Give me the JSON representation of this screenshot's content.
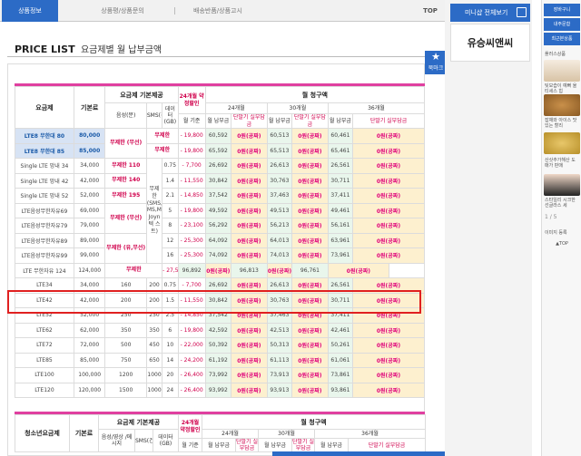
{
  "tabs": {
    "info": "상품정보",
    "review": "상품평/상품문의",
    "delivery": "배송반품/상품고시",
    "top": "TOP"
  },
  "title": {
    "en": "PRICE LIST",
    "ko": "요금제별 월 납부금액"
  },
  "badge": "북마크",
  "mini": {
    "title": "미니샵 전체보기",
    "seller": "유승씨앤씨"
  },
  "rail": {
    "cart": "장바구니",
    "order": "내주문함",
    "recent": "최근본상품",
    "count_label": "플러스상품",
    "pager": "1 / 5",
    "items": [
      "팃모습이 예뻐 울티세스 힙",
      "잡채와 아이스 맛있는 할리",
      "산삿추가해산 도매가 판매",
      "스타일리 시크한 선글라스 세"
    ],
    "delete": "이미지 등록",
    "top": "▲TOP"
  },
  "table": {
    "header": {
      "plan": "요금제",
      "base": "기본료",
      "provide": "요금제 기본제공",
      "voice": "음성(분)",
      "voice_sub": "망내 망외",
      "sms": "SMS(건)",
      "data": "데이터(GB)",
      "discount": "24개월 약정할인",
      "monthly": "월 기준",
      "bill": "월 청구액",
      "m24": "24개월",
      "m30": "30개월",
      "m36": "36개월",
      "pay": "월 납부금",
      "device": "단말기 실부담금"
    },
    "rows": [
      {
        "plan": "LTE8 무한대 80",
        "base": "80,000",
        "voice": "무제한 (무선)",
        "sms": "무제한",
        "data": "",
        "disc": "- 19,800",
        "p24": "60,592",
        "d24": "0원(공짜)",
        "p30": "60,513",
        "d30": "0원(공짜)",
        "p36": "60,461",
        "d36": "0원(공짜)"
      },
      {
        "plan": "LTE8 무한대 85",
        "base": "85,000",
        "voice": "",
        "sms": "무제한",
        "data": "",
        "disc": "- 19,800",
        "p24": "65,592",
        "d24": "0원(공짜)",
        "p30": "65,513",
        "d30": "0원(공짜)",
        "p36": "65,461",
        "d36": "0원(공짜)"
      },
      {
        "plan": "Single LTE 망내 34",
        "base": "34,000",
        "voice": "무제한 110",
        "sms": "",
        "data": "0.75",
        "disc": "- 7,700",
        "p24": "26,692",
        "d24": "0원(공짜)",
        "p30": "26,613",
        "d30": "0원(공짜)",
        "p36": "26,561",
        "d36": "0원(공짜)"
      },
      {
        "plan": "Single LTE 망내 42",
        "base": "42,000",
        "voice": "무제한 140",
        "sms": "무제한 (SMS,L MS,MMS Joyn 텍 스트)",
        "data": "1.4",
        "disc": "- 11,550",
        "p24": "30,842",
        "d24": "0원(공짜)",
        "p30": "30,763",
        "d30": "0원(공짜)",
        "p36": "30,711",
        "d36": "0원(공짜)"
      },
      {
        "plan": "Single LTE 망내 52",
        "base": "52,000",
        "voice": "무제한 195",
        "sms": "",
        "data": "2.1",
        "disc": "- 14,850",
        "p24": "37,542",
        "d24": "0원(공짜)",
        "p30": "37,463",
        "d30": "0원(공짜)",
        "p36": "37,411",
        "d36": "0원(공짜)"
      },
      {
        "plan": "LTE음성무한자유69",
        "base": "69,000",
        "voice": "무제한 (무선)",
        "sms": "",
        "data": "5",
        "disc": "- 19,800",
        "p24": "49,592",
        "d24": "0원(공짜)",
        "p30": "49,513",
        "d30": "0원(공짜)",
        "p36": "49,461",
        "d36": "0원(공짜)"
      },
      {
        "plan": "LTE음성무한자유79",
        "base": "79,000",
        "voice": "",
        "sms": "",
        "data": "8",
        "disc": "- 23,100",
        "p24": "56,292",
        "d24": "0원(공짜)",
        "p30": "56,213",
        "d30": "0원(공짜)",
        "p36": "56,161",
        "d36": "0원(공짜)"
      },
      {
        "plan": "LTE음성무한자유89",
        "base": "89,000",
        "voice": "무제한 (유,무선)",
        "sms": "",
        "data": "12",
        "disc": "- 25,300",
        "p24": "64,092",
        "d24": "0원(공짜)",
        "p30": "64,013",
        "d30": "0원(공짜)",
        "p36": "63,961",
        "d36": "0원(공짜)"
      },
      {
        "plan": "LTE음성무한자유99",
        "base": "99,000",
        "voice": "",
        "sms": "",
        "data": "16",
        "disc": "- 25,300",
        "p24": "74,092",
        "d24": "0원(공짜)",
        "p30": "74,013",
        "d30": "0원(공짜)",
        "p36": "73,961",
        "d36": "0원(공짜)"
      },
      {
        "plan": "LTE 무한자유 124",
        "base": "124,000",
        "voice": "무제한",
        "sms": "",
        "data": "",
        "disc": "- 27,500",
        "p24": "96,892",
        "d24": "0원(공짜)",
        "p30": "96,813",
        "d30": "0원(공짜)",
        "p36": "96,761",
        "d36": "0원(공짜)"
      },
      {
        "plan": "LTE34",
        "base": "34,000",
        "voice": "160",
        "sms": "200",
        "data": "0.75",
        "disc": "- 7,700",
        "p24": "26,692",
        "d24": "0원(공짜)",
        "p30": "26,613",
        "d30": "0원(공짜)",
        "p36": "26,561",
        "d36": "0원(공짜)"
      },
      {
        "plan": "LTE42",
        "base": "42,000",
        "voice": "200",
        "sms": "200",
        "data": "1.5",
        "disc": "- 11,550",
        "p24": "30,842",
        "d24": "0원(공짜)",
        "p30": "30,763",
        "d30": "0원(공짜)",
        "p36": "30,711",
        "d36": "0원(공짜)"
      },
      {
        "plan": "LTE52",
        "base": "52,000",
        "voice": "250",
        "sms": "250",
        "data": "2.5",
        "disc": "- 14,850",
        "p24": "37,542",
        "d24": "0원(공짜)",
        "p30": "37,463",
        "d30": "0원(공짜)",
        "p36": "37,411",
        "d36": "0원(공짜)"
      },
      {
        "plan": "LTE62",
        "base": "62,000",
        "voice": "350",
        "sms": "350",
        "data": "6",
        "disc": "- 19,800",
        "p24": "42,592",
        "d24": "0원(공짜)",
        "p30": "42,513",
        "d30": "0원(공짜)",
        "p36": "42,461",
        "d36": "0원(공짜)"
      },
      {
        "plan": "LTE72",
        "base": "72,000",
        "voice": "500",
        "sms": "450",
        "data": "10",
        "disc": "- 22,000",
        "p24": "50,392",
        "d24": "0원(공짜)",
        "p30": "50,313",
        "d30": "0원(공짜)",
        "p36": "50,261",
        "d36": "0원(공짜)"
      },
      {
        "plan": "LTE85",
        "base": "85,000",
        "voice": "750",
        "sms": "650",
        "data": "14",
        "disc": "- 24,200",
        "p24": "61,192",
        "d24": "0원(공짜)",
        "p30": "61,113",
        "d30": "0원(공짜)",
        "p36": "61,061",
        "d36": "0원(공짜)"
      },
      {
        "plan": "LTE100",
        "base": "100,000",
        "voice": "1200",
        "sms": "1000",
        "data": "20",
        "disc": "- 26,400",
        "p24": "73,992",
        "d24": "0원(공짜)",
        "p30": "73,913",
        "d30": "0원(공짜)",
        "p36": "73,861",
        "d36": "0원(공짜)"
      },
      {
        "plan": "LTE120",
        "base": "120,000",
        "voice": "1500",
        "sms": "1000",
        "data": "24",
        "disc": "- 26,400",
        "p24": "93,992",
        "d24": "0원(공짜)",
        "p30": "93,913",
        "d30": "0원(공짜)",
        "p36": "93,861",
        "d36": "0원(공짜)"
      }
    ]
  },
  "table2": {
    "plan": "청소년요금제",
    "base": "기본료",
    "provide": "요금제 기본제공",
    "voice": "음성/영상 /메시지",
    "sms": "SMS(건)",
    "data": "데이터(GB)",
    "discount": "24개월 약정할인",
    "monthly": "월 기준",
    "bill": "월 청구액",
    "m24": "24개월",
    "m30": "30개월",
    "m36": "36개월",
    "pay": "월 납부금",
    "device": "단말기 실부담금"
  }
}
